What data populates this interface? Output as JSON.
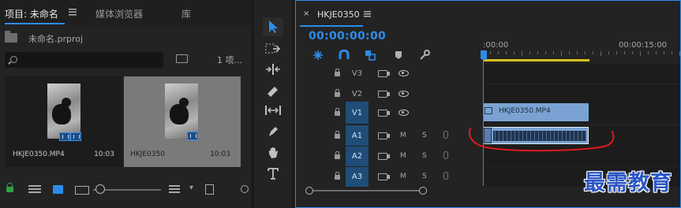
{
  "project_panel": {
    "tabs": [
      {
        "label": "项目: 未命名",
        "active": true
      },
      {
        "label": "媒体浏览器",
        "active": false
      },
      {
        "label": "库",
        "active": false
      }
    ],
    "project_file": "未命名.prproj",
    "search": {
      "value": "",
      "placeholder": ""
    },
    "item_count": "1 项...",
    "clips": [
      {
        "name": "HKJE0350.MP4",
        "duration": "10:03",
        "selected": false
      },
      {
        "name": "HKJE0350",
        "duration": "10:03",
        "selected": true
      }
    ],
    "footer_icons": [
      "lock-icon",
      "list-view-icon",
      "icon-view-icon",
      "freeform-view-icon",
      "zoom-slider",
      "sort-icon",
      "chevron-down-icon",
      "new-item-icon",
      "search-icon"
    ]
  },
  "tools_panel": {
    "tools": [
      "selection-tool",
      "track-select-forward-tool",
      "ripple-edit-tool",
      "razor-tool",
      "slip-tool",
      "pen-tool",
      "hand-tool",
      "type-tool"
    ],
    "selected": "selection-tool"
  },
  "timeline": {
    "close_label": "×",
    "sequence_name": "HKJE0350",
    "timecode": "00:00:00:00",
    "ruler_labels": [
      ":00:00",
      "00:00:15:00"
    ],
    "toolbar_icons": [
      "snap-icon",
      "magnet-icon",
      "linked-selection-icon",
      "add-marker-icon",
      "wrench-icon"
    ],
    "tracks": [
      {
        "label": "V3",
        "type": "video",
        "targeted": false
      },
      {
        "label": "V2",
        "type": "video",
        "targeted": false
      },
      {
        "label": "V1",
        "type": "video",
        "targeted": true,
        "clip": "HKJE0350.MP4"
      },
      {
        "label": "A1",
        "type": "audio",
        "targeted": true,
        "mute": "M",
        "solo": "S",
        "has_clip": true
      },
      {
        "label": "A2",
        "type": "audio",
        "targeted": true,
        "mute": "M",
        "solo": "S"
      },
      {
        "label": "A3",
        "type": "audio",
        "targeted": true,
        "mute": "M",
        "solo": "S"
      }
    ]
  },
  "watermark": "最需教育",
  "colors": {
    "accent": "#2d8ceb",
    "clip": "#7aa3d3",
    "work_area": "#d9c21d",
    "annotation": "#e0191c"
  }
}
